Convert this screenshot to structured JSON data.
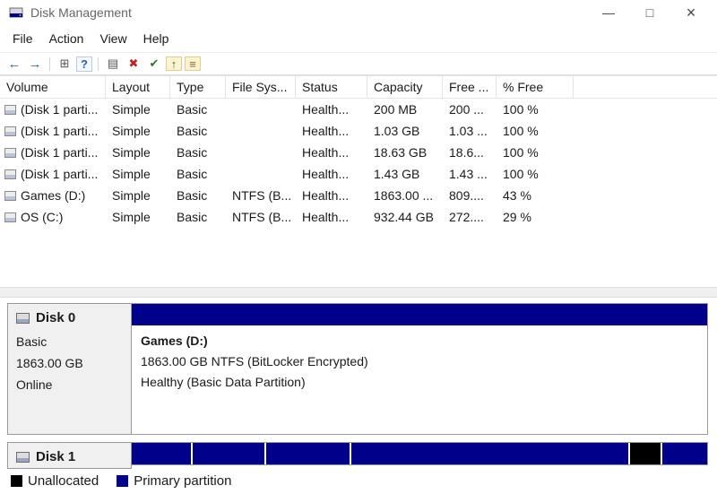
{
  "window": {
    "title": "Disk Management",
    "minimize": "—",
    "maximize": "□",
    "close": "×"
  },
  "menu": {
    "items": [
      "File",
      "Action",
      "View",
      "Help"
    ]
  },
  "toolbar": {
    "icons": [
      {
        "name": "back",
        "glyph": "←"
      },
      {
        "name": "forward",
        "glyph": "→"
      },
      {
        "name": "console-tree",
        "glyph": "⊞"
      },
      {
        "name": "help",
        "glyph": "?"
      },
      {
        "name": "properties",
        "glyph": "▤"
      },
      {
        "name": "delete-volume",
        "glyph": "✖"
      },
      {
        "name": "mark-partition",
        "glyph": "✔"
      },
      {
        "name": "open-folder",
        "glyph": "↑"
      },
      {
        "name": "views",
        "glyph": "≡"
      }
    ]
  },
  "table": {
    "columns": [
      "Volume",
      "Layout",
      "Type",
      "File Sys...",
      "Status",
      "Capacity",
      "Free ...",
      "% Free"
    ],
    "rows": [
      {
        "volume": "(Disk 1 parti...",
        "layout": "Simple",
        "type": "Basic",
        "file_system": "",
        "status": "Health...",
        "capacity": "200 MB",
        "free_space": "200 ...",
        "pct_free": "100 %"
      },
      {
        "volume": "(Disk 1 parti...",
        "layout": "Simple",
        "type": "Basic",
        "file_system": "",
        "status": "Health...",
        "capacity": "1.03 GB",
        "free_space": "1.03 ...",
        "pct_free": "100 %"
      },
      {
        "volume": "(Disk 1 parti...",
        "layout": "Simple",
        "type": "Basic",
        "file_system": "",
        "status": "Health...",
        "capacity": "18.63 GB",
        "free_space": "18.6...",
        "pct_free": "100 %"
      },
      {
        "volume": "(Disk 1 parti...",
        "layout": "Simple",
        "type": "Basic",
        "file_system": "",
        "status": "Health...",
        "capacity": "1.43 GB",
        "free_space": "1.43 ...",
        "pct_free": "100 %"
      },
      {
        "volume": "Games (D:)",
        "layout": "Simple",
        "type": "Basic",
        "file_system": "NTFS (B...",
        "status": "Health...",
        "capacity": "1863.00 ...",
        "free_space": "809....",
        "pct_free": "43 %"
      },
      {
        "volume": "OS (C:)",
        "layout": "Simple",
        "type": "Basic",
        "file_system": "NTFS (B...",
        "status": "Health...",
        "capacity": "932.44 GB",
        "free_space": "272....",
        "pct_free": "29 %"
      }
    ]
  },
  "disk_view": {
    "disks": [
      {
        "name": "Disk 0",
        "type": "Basic",
        "size": "1863.00 GB",
        "status": "Online",
        "partition": {
          "title": "Games  (D:)",
          "detail": "1863.00 GB NTFS (BitLocker Encrypted)",
          "status": "Healthy (Basic Data Partition)"
        }
      },
      {
        "name": "Disk 1",
        "segments": [
          {
            "type": "primary_partition",
            "width_pct": 10.6
          },
          {
            "type": "primary_partition",
            "width_pct": 12.8
          },
          {
            "type": "primary_partition",
            "width_pct": 14.8
          },
          {
            "type": "primary_partition",
            "width_pct": 48.4
          },
          {
            "type": "unallocated",
            "width_pct": 5.6
          },
          {
            "type": "primary_partition",
            "width_pct": 7.8
          }
        ]
      }
    ]
  },
  "legend": {
    "items": [
      {
        "label": "Unallocated",
        "type": "unallocated"
      },
      {
        "label": "Primary partition",
        "type": "primary_partition"
      }
    ]
  },
  "colors": {
    "primary_partition": "#00008B",
    "unallocated": "#000000"
  }
}
